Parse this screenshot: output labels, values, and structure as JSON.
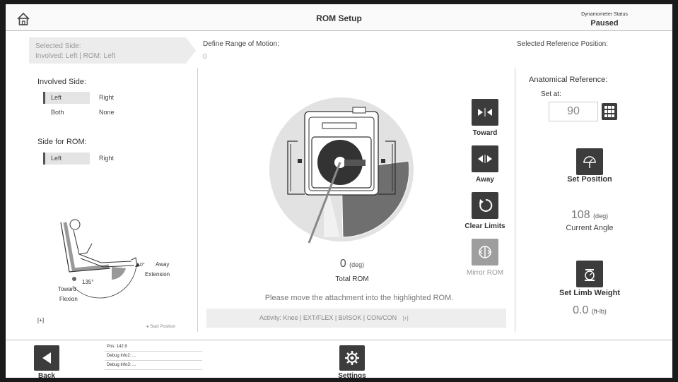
{
  "header": {
    "title": "ROM Setup",
    "dynamometer_label": "Dynamometer Status",
    "dynamometer_status": "Paused"
  },
  "selected_side": {
    "label": "Selected Side:",
    "value": "Involved: Left | ROM: Left"
  },
  "define_rom": {
    "label": "Define Range of Motion:",
    "value": "0"
  },
  "reference": {
    "label": "Selected Reference Position:"
  },
  "involved_side": {
    "label": "Involved Side:",
    "options": [
      "Left",
      "Right",
      "Both",
      "None"
    ],
    "selected": "Left"
  },
  "side_for_rom": {
    "label": "Side for ROM:",
    "options": [
      "Left",
      "Right"
    ],
    "selected": "Left"
  },
  "leg_diagram": {
    "angle_0": "0°",
    "angle_135": "135°",
    "away": "Away",
    "extension": "Extension",
    "toward": "Toward",
    "flexion": "Flexion",
    "start_position": "Start Position",
    "expand": "[+]"
  },
  "controls": {
    "toward": "Toward",
    "away": "Away",
    "clear_limits": "Clear Limits",
    "mirror_rom": "Mirror ROM"
  },
  "total_rom": {
    "value": "0",
    "unit": "(deg)",
    "label": "Total ROM"
  },
  "hint": "Please move the attachment into the highlighted ROM.",
  "activity": {
    "text": "Activity:  Knee | EXT/FLEX | BI/ISOK | CON/CON",
    "expand": "[+]"
  },
  "anatomical": {
    "label": "Anatomical Reference:",
    "set_at_label": "Set at:",
    "set_at_value": "90"
  },
  "set_position": {
    "label": "Set Position"
  },
  "current_angle": {
    "value": "108",
    "unit": "(deg)",
    "label": "Current Angle"
  },
  "limb_weight": {
    "label": "Set Limb Weight",
    "value": "0.0",
    "unit": "(ft-lb)"
  },
  "footer": {
    "back": "Back",
    "settings": "Settings",
    "debug": [
      "Pos: 142.9",
      "Debug Info2: ...",
      "Debug Info3: ..."
    ]
  }
}
